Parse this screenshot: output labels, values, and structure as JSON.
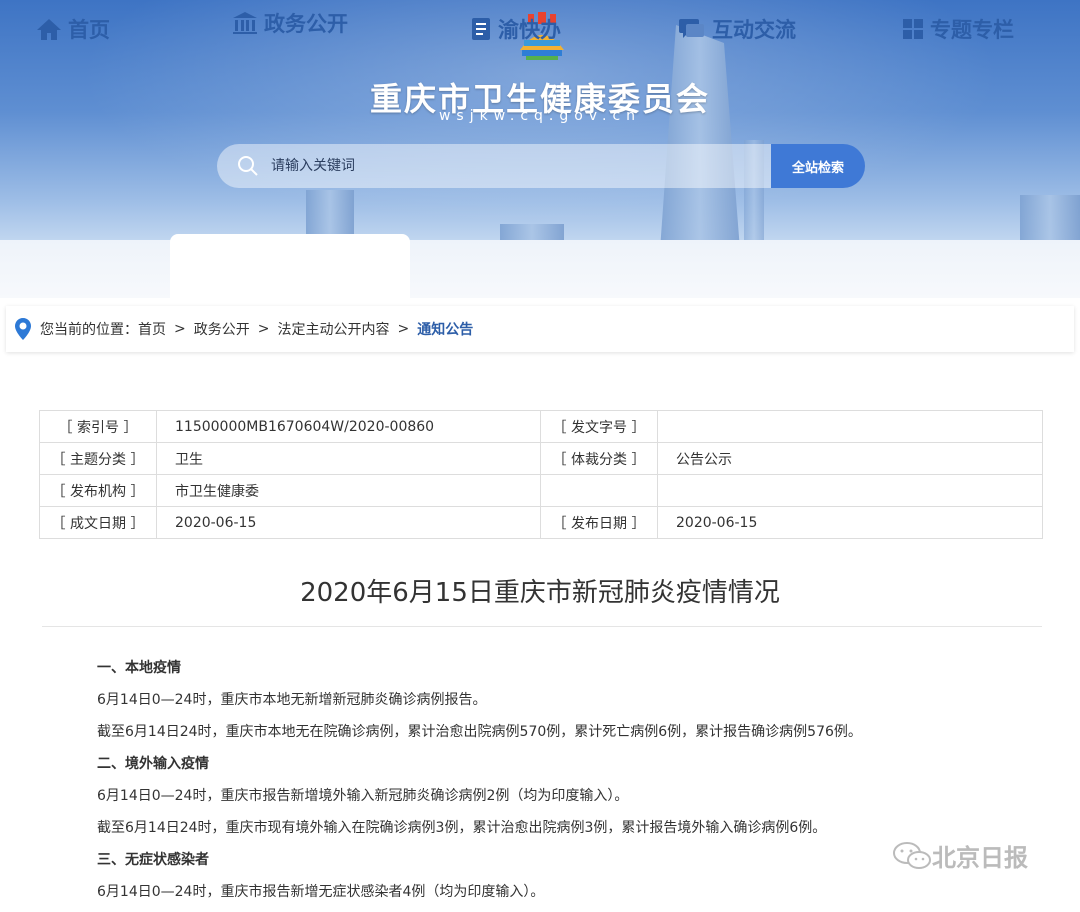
{
  "site": {
    "title": "重庆市卫生健康委员会",
    "url": "wsjkw.cq.gov.cn"
  },
  "search": {
    "placeholder": "请输入关键词",
    "button_label": "全站检索"
  },
  "nav": {
    "items": [
      {
        "label": "首页",
        "icon": "home-icon"
      },
      {
        "label": "政务公开",
        "icon": "government-building-icon",
        "active": true
      },
      {
        "label": "渝快办",
        "icon": "document-list-icon"
      },
      {
        "label": "互动交流",
        "icon": "chat-icon"
      },
      {
        "label": "专题专栏",
        "icon": "grid-icon"
      }
    ]
  },
  "breadcrumb": {
    "prefix": "您当前的位置：",
    "items": [
      "首页",
      "政务公开",
      "法定主动公开内容",
      "通知公告"
    ],
    "separator": ">"
  },
  "meta": {
    "rows": [
      {
        "k1": "［ 索引号 ］",
        "v1": "11500000MB1670604W/2020-00860",
        "k2": "［ 发文字号 ］",
        "v2": ""
      },
      {
        "k1": "［ 主题分类 ］",
        "v1": "卫生",
        "k2": "［ 体裁分类 ］",
        "v2": "公告公示"
      },
      {
        "k1": "［ 发布机构 ］",
        "v1": "市卫生健康委",
        "k2": "",
        "v2": ""
      },
      {
        "k1": "［ 成文日期 ］",
        "v1": "2020-06-15",
        "k2": "［ 发布日期 ］",
        "v2": "2020-06-15"
      }
    ]
  },
  "article": {
    "title": "2020年6月15日重庆市新冠肺炎疫情情况",
    "paragraphs": [
      {
        "text": "一、本地疫情",
        "heading": true
      },
      {
        "text": "6月14日0—24时，重庆市本地无新增新冠肺炎确诊病例报告。",
        "heading": false
      },
      {
        "text": "截至6月14日24时，重庆市本地无在院确诊病例，累计治愈出院病例570例，累计死亡病例6例，累计报告确诊病例576例。",
        "heading": false
      },
      {
        "text": "二、境外输入疫情",
        "heading": true
      },
      {
        "text": "6月14日0—24时，重庆市报告新增境外输入新冠肺炎确诊病例2例（均为印度输入）。",
        "heading": false
      },
      {
        "text": "截至6月14日24时，重庆市现有境外输入在院确诊病例3例，累计治愈出院病例3例，累计报告境外输入确诊病例6例。",
        "heading": false
      },
      {
        "text": "三、无症状感染者",
        "heading": true
      },
      {
        "text": "6月14日0—24时，重庆市报告新增无症状感染者4例（均为印度输入）。",
        "heading": false
      }
    ]
  },
  "watermark": {
    "text": "北京日报",
    "icon": "wechat-icon"
  },
  "colors": {
    "brand_blue": "#2d5ea8",
    "button_blue": "#3f79d6"
  }
}
